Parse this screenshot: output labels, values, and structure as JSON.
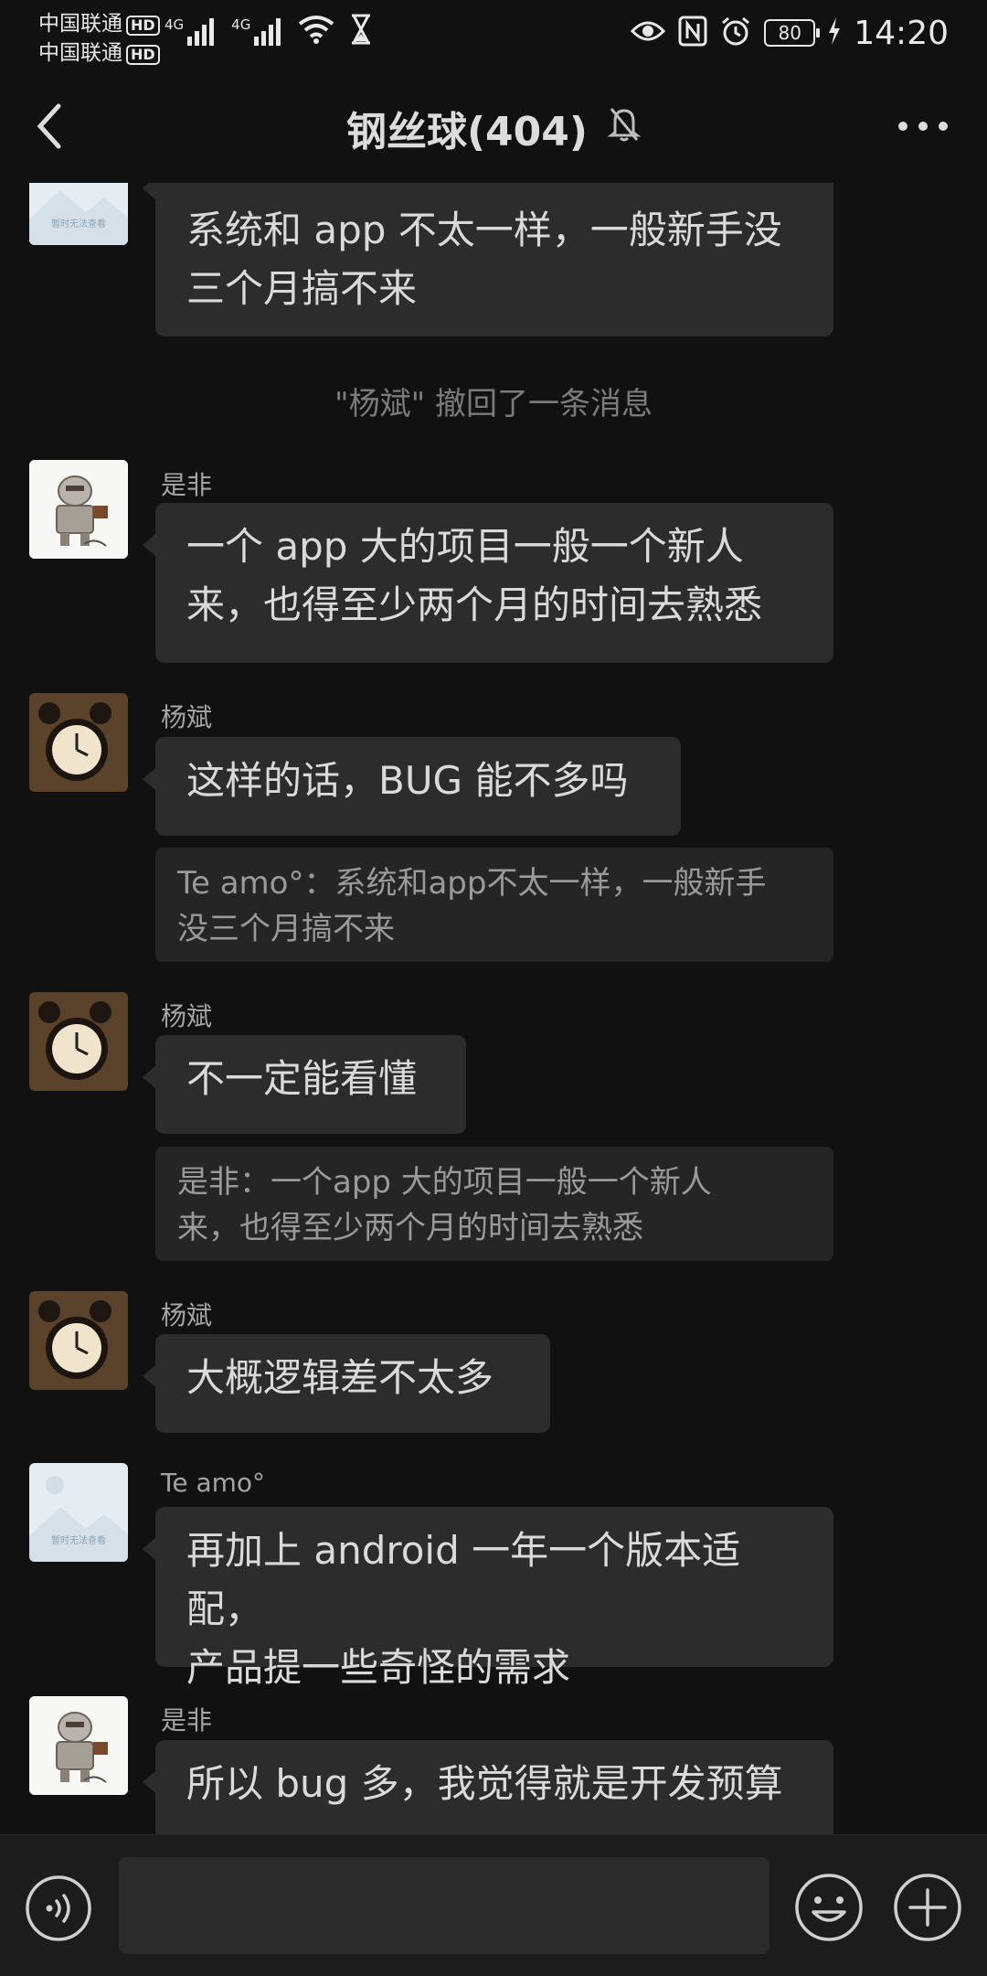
{
  "status_bar": {
    "carrier1": "中国联通",
    "carrier2": "中国联通",
    "hd_badge": "HD",
    "network1": "4G",
    "network2": "4G",
    "battery": "80",
    "time": "14:20",
    "icons": [
      "signal-icon",
      "wifi-icon",
      "hourglass-icon",
      "eye-icon",
      "nfc-icon",
      "alarm-icon",
      "battery-icon",
      "charging-icon"
    ]
  },
  "header": {
    "title": "钢丝球(404)",
    "muted_icon": "bell-off-icon"
  },
  "messages": {
    "m1": {
      "text_line1": "系统和 app 不太一样，一般新手没",
      "text_line2": "三个月搞不来"
    },
    "sys": {
      "text": "\"杨斌\" 撤回了一条消息"
    },
    "m2": {
      "sender": "是非",
      "text_line1": "一个 app 大的项目一般一个新人",
      "text_line2": "来，也得至少两个月的时间去熟悉"
    },
    "m3": {
      "sender": "杨斌",
      "text": "这样的话，BUG 能不多吗",
      "quote_line1": "Te amo°：系统和app不太一样，一般新手",
      "quote_line2": "没三个月搞不来"
    },
    "m4": {
      "sender": "杨斌",
      "text": "不一定能看懂",
      "quote_line1": "是非：一个app 大的项目一般一个新人",
      "quote_line2": "来，也得至少两个月的时间去熟悉"
    },
    "m5": {
      "sender": "杨斌",
      "text": "大概逻辑差不太多"
    },
    "m6": {
      "sender": "Te amo°",
      "text_line1": "再加上 android 一年一个版本适配，",
      "text_line2": "产品提一些奇怪的需求",
      "avatar_caption": "暂时无法查看"
    },
    "m7": {
      "sender": "是非",
      "text_line1": "所以 bug 多，我觉得就是开发预算"
    },
    "m1_avatar_caption": "暂时无法查看"
  },
  "input": {
    "placeholder": ""
  },
  "colors": {
    "background": "#111111",
    "bubble": "#2c2c2c",
    "quote": "#252525",
    "input_bar": "#1c1c1c"
  }
}
